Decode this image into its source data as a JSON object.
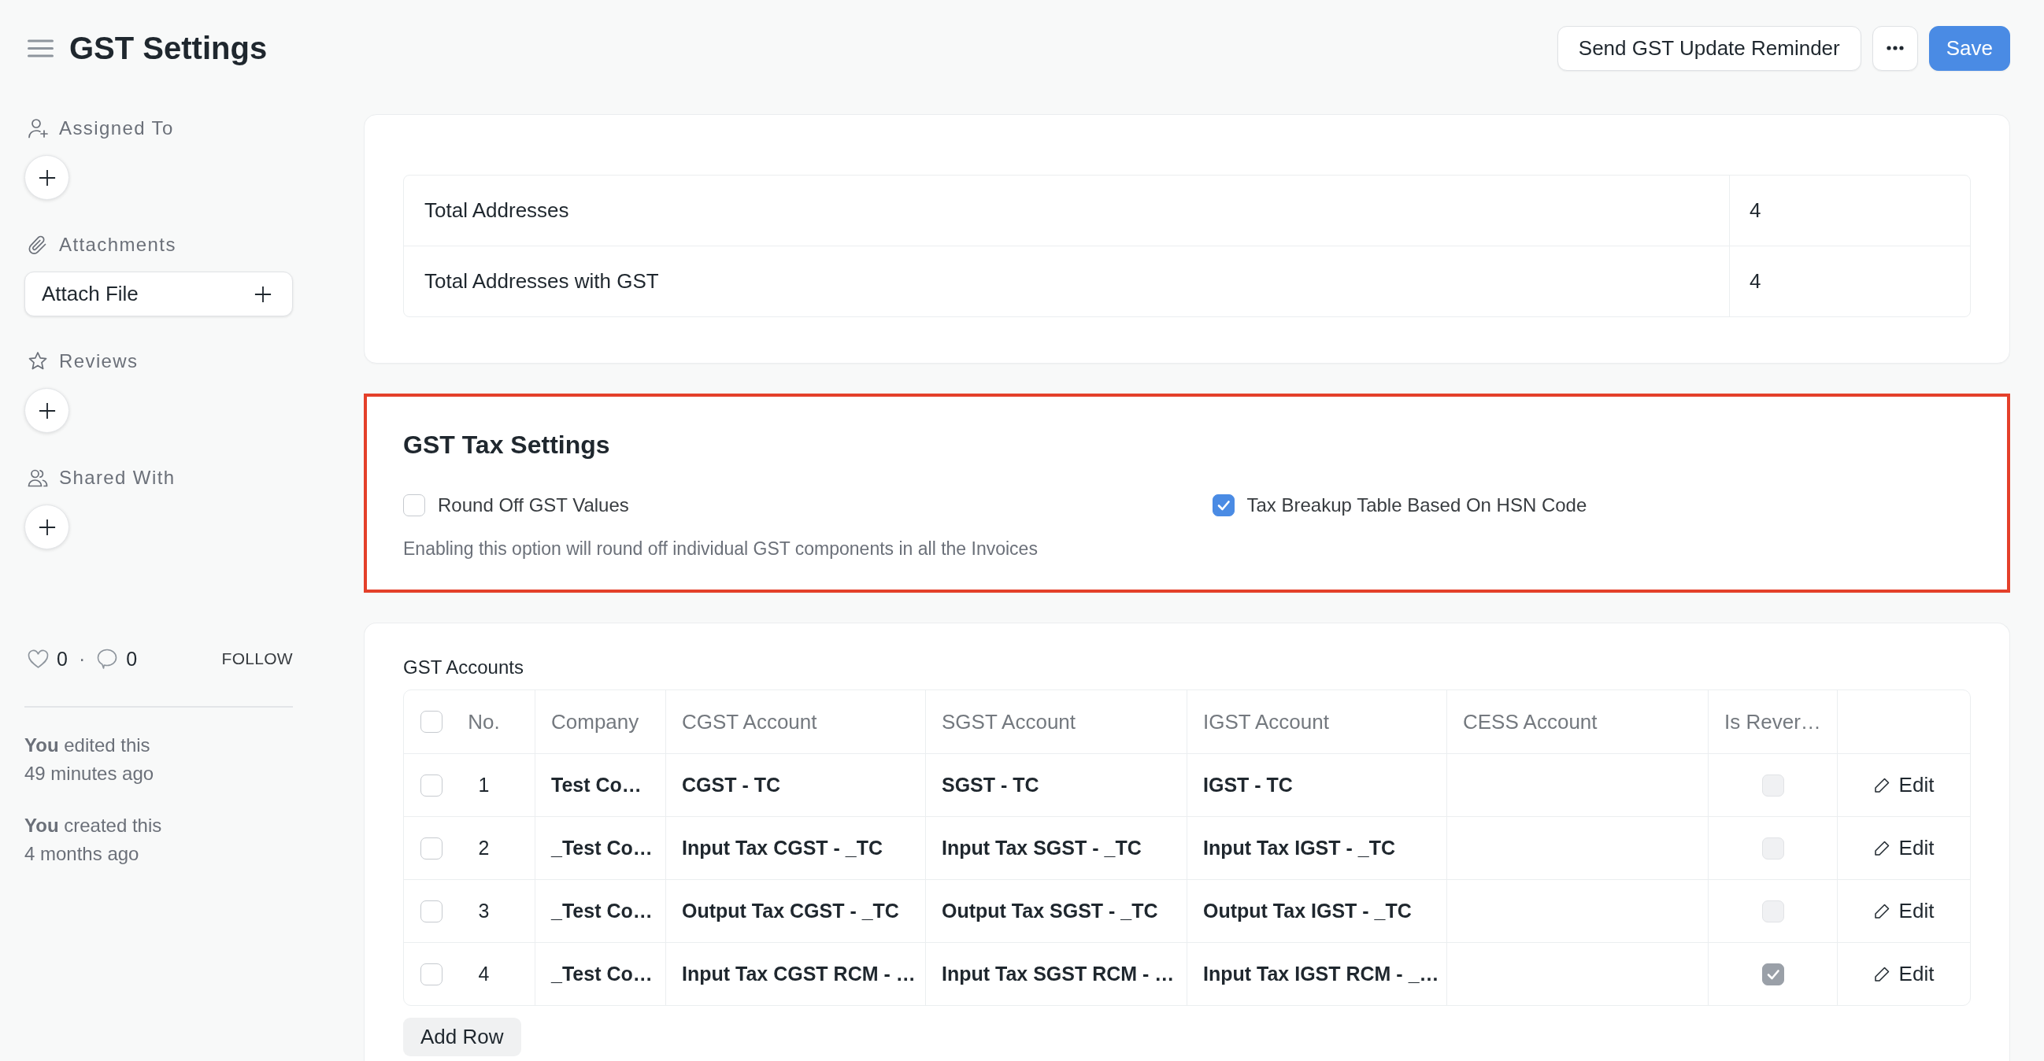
{
  "header": {
    "title": "GST Settings",
    "actions": [
      {
        "kind": "secondary",
        "label": "Send GST Update Reminder"
      },
      {
        "kind": "more"
      },
      {
        "kind": "primary",
        "label": "Save"
      }
    ]
  },
  "sidebar": {
    "sections": [
      {
        "kind": "assign",
        "label": "Assigned To"
      },
      {
        "kind": "attach",
        "label": "Attachments",
        "button": "Attach File"
      },
      {
        "kind": "review",
        "label": "Reviews"
      },
      {
        "kind": "share",
        "label": "Shared With"
      }
    ],
    "likes": "0",
    "separator": "·",
    "comments": "0",
    "follow": "FOLLOW",
    "activity": [
      {
        "text": "**You** edited this",
        "time": "49 minutes ago"
      },
      {
        "text": "**You** created this",
        "time": "4 months ago"
      }
    ]
  },
  "summary": {
    "rows": [
      {
        "label": "Total Addresses",
        "value": "4"
      },
      {
        "label": "Total Addresses with GST",
        "value": "4"
      }
    ]
  },
  "tax_settings": {
    "title": "GST Tax Settings",
    "highlighted": true,
    "fields": [
      {
        "label": "Round Off GST Values",
        "checked": false,
        "description": "Enabling this option will round off individual GST components in all the Invoices"
      },
      {
        "label": "Tax Breakup Table Based On HSN Code",
        "checked": true
      }
    ]
  },
  "accounts": {
    "label": "GST Accounts",
    "header_checkbox": {
      "checked": false
    },
    "columns": [
      "No.",
      "Company",
      "CGST Account",
      "SGST Account",
      "IGST Account",
      "CESS Account",
      "Is Rever…"
    ],
    "rows": [
      {
        "selected": false,
        "no": "1",
        "company": "Test Co…",
        "cgst_account": "CGST - TC",
        "sgst_account": "SGST - TC",
        "igst_account": "IGST - TC",
        "column_7": {
          "checked": false,
          "disabled": true
        },
        "action": "Edit"
      },
      {
        "selected": false,
        "no": "2",
        "company": "_Test Co…",
        "cgst_account": "Input Tax CGST - _TC",
        "sgst_account": "Input Tax SGST - _TC",
        "igst_account": "Input Tax IGST - _TC",
        "column_7": {
          "checked": false,
          "disabled": true
        },
        "action": "Edit"
      },
      {
        "selected": false,
        "no": "3",
        "company": "_Test Co…",
        "cgst_account": "Output Tax CGST - _TC",
        "sgst_account": "Output Tax SGST - _TC",
        "igst_account": "Output Tax IGST - _TC",
        "column_7": {
          "checked": false,
          "disabled": true
        },
        "action": "Edit"
      },
      {
        "selected": false,
        "no": "4",
        "company": "_Test Co…",
        "cgst_account": "Input Tax CGST RCM - …",
        "sgst_account": "Input Tax SGST RCM - …",
        "igst_account": "Input Tax IGST RCM - _…",
        "column_7": {
          "checked": true,
          "disabled": true
        },
        "action": "Edit"
      }
    ],
    "add_row": "Add Row"
  }
}
